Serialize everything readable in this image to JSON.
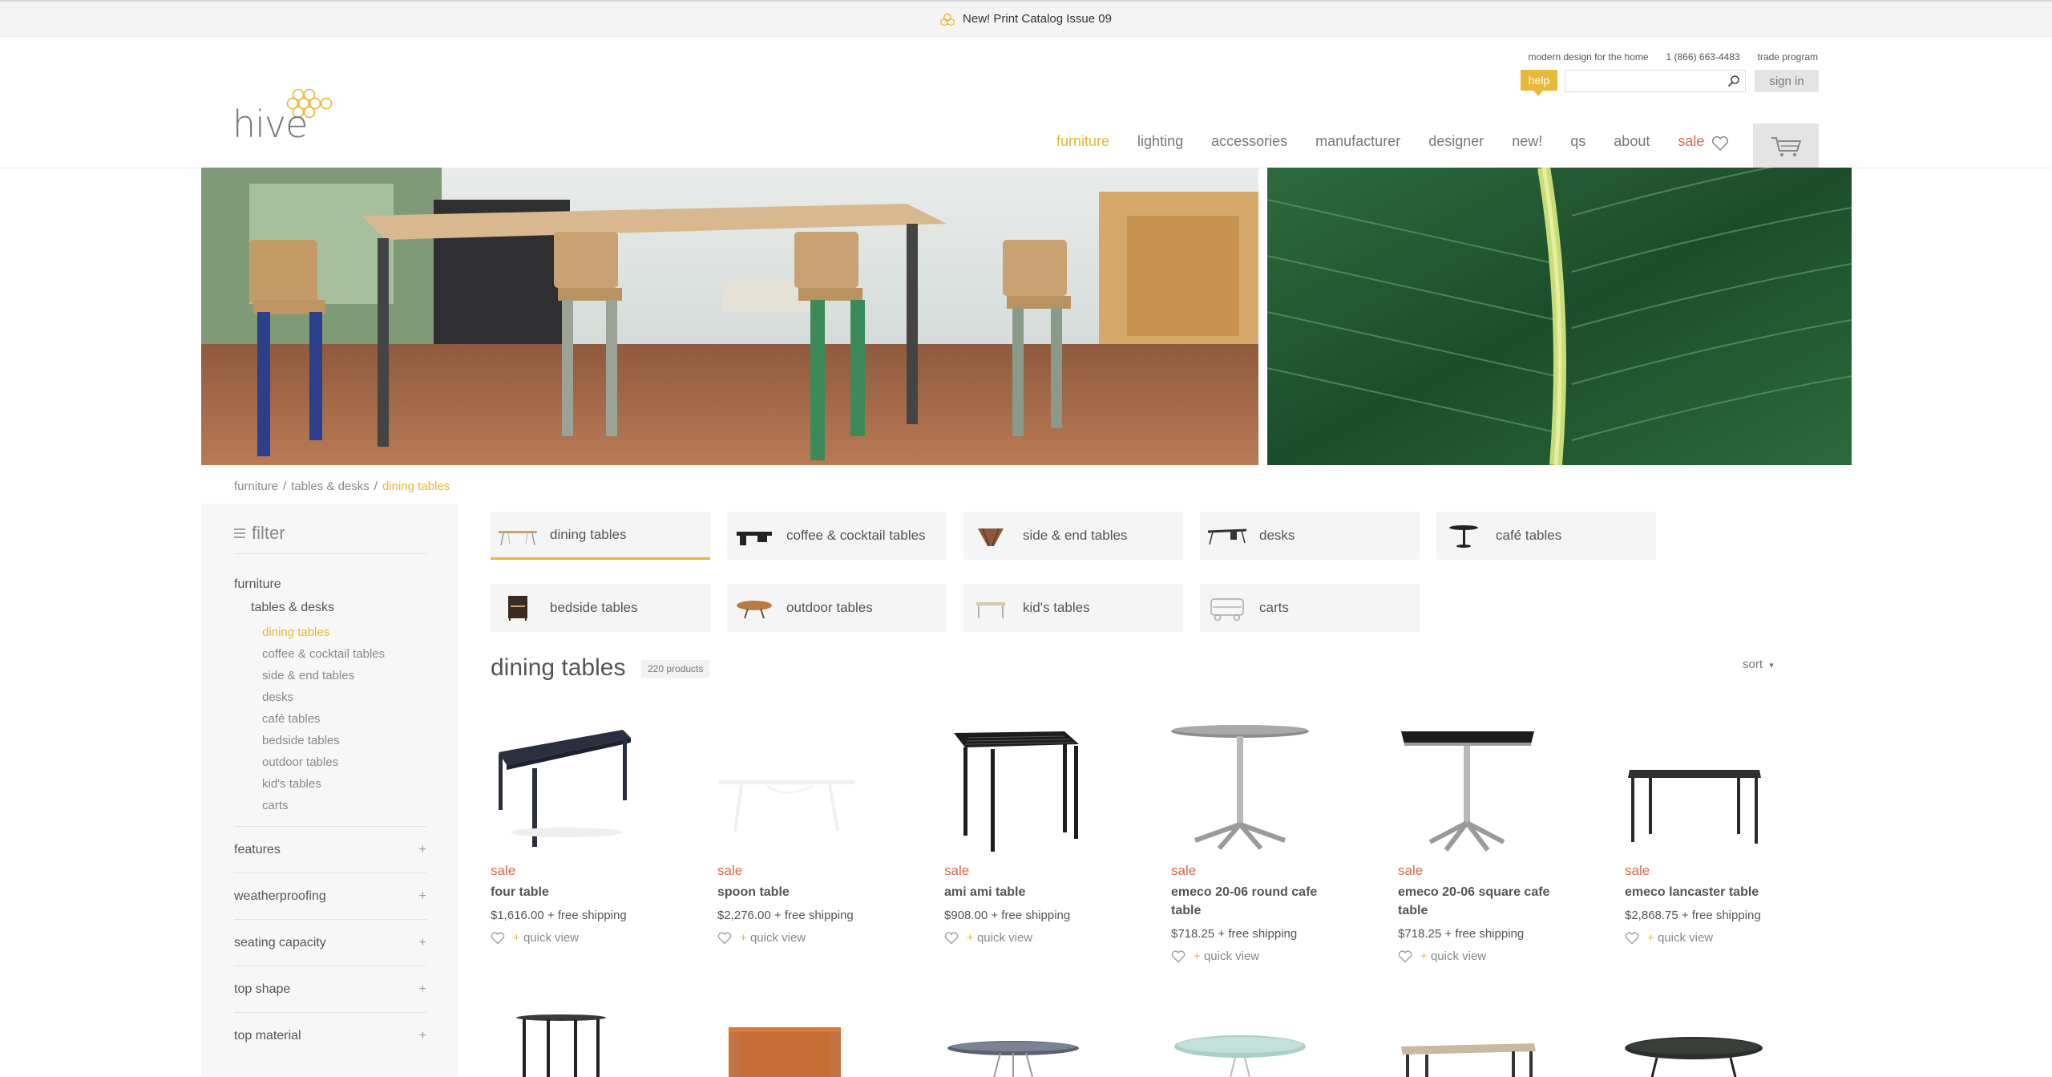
{
  "announcement": {
    "icon": "hive-logo-icon",
    "text": "New! Print Catalog Issue 09"
  },
  "header": {
    "logo_text": "hive",
    "tagline": "modern design for the home",
    "phone": "1 (866) 663-4483",
    "trade": "trade program",
    "help_label": "help",
    "search_placeholder": "",
    "signin_label": "sign in"
  },
  "nav": {
    "items": [
      "furniture",
      "lighting",
      "accessories",
      "manufacturer",
      "designer",
      "new!",
      "qs",
      "about",
      "sale"
    ],
    "active": "furniture"
  },
  "breadcrumb": {
    "a": "furniture",
    "b": "tables & desks",
    "c": "dining tables",
    "sep": "/"
  },
  "filter": {
    "title": "filter",
    "root": "furniture",
    "sub": "tables & desks",
    "categories": [
      "dining tables",
      "coffee & cocktail tables",
      "side & end tables",
      "desks",
      "café tables",
      "bedside tables",
      "outdoor tables",
      "kid's tables",
      "carts"
    ],
    "facets": [
      "features",
      "weatherproofing",
      "seating capacity",
      "top shape",
      "top material"
    ],
    "plus": "+"
  },
  "tiles": {
    "items": [
      "dining tables",
      "coffee & cocktail tables",
      "side & end tables",
      "desks",
      "café tables",
      "bedside tables",
      "outdoor tables",
      "kid's tables",
      "carts"
    ]
  },
  "listing": {
    "title": "dining tables",
    "count": "220 products",
    "sort": "sort",
    "sort_caret": "▾",
    "quick_view": "quick view",
    "plus": "+",
    "products": [
      {
        "badge": "sale",
        "name": "four table",
        "price": "$1,616.00 + free shipping"
      },
      {
        "badge": "sale",
        "name": "spoon table",
        "price": "$2,276.00 + free shipping"
      },
      {
        "badge": "sale",
        "name": "ami ami table",
        "price": "$908.00 + free shipping"
      },
      {
        "badge": "sale",
        "name": "emeco 20-06 round cafe table",
        "price": "$718.25 + free shipping"
      },
      {
        "badge": "sale",
        "name": "emeco 20-06 square cafe table",
        "price": "$718.25 + free shipping"
      },
      {
        "badge": "sale",
        "name": "emeco lancaster table",
        "price": "$2,868.75 + free shipping"
      }
    ]
  },
  "colors": {
    "accent": "#e8b83a",
    "sale": "#d96a4a",
    "text": "#555555"
  }
}
